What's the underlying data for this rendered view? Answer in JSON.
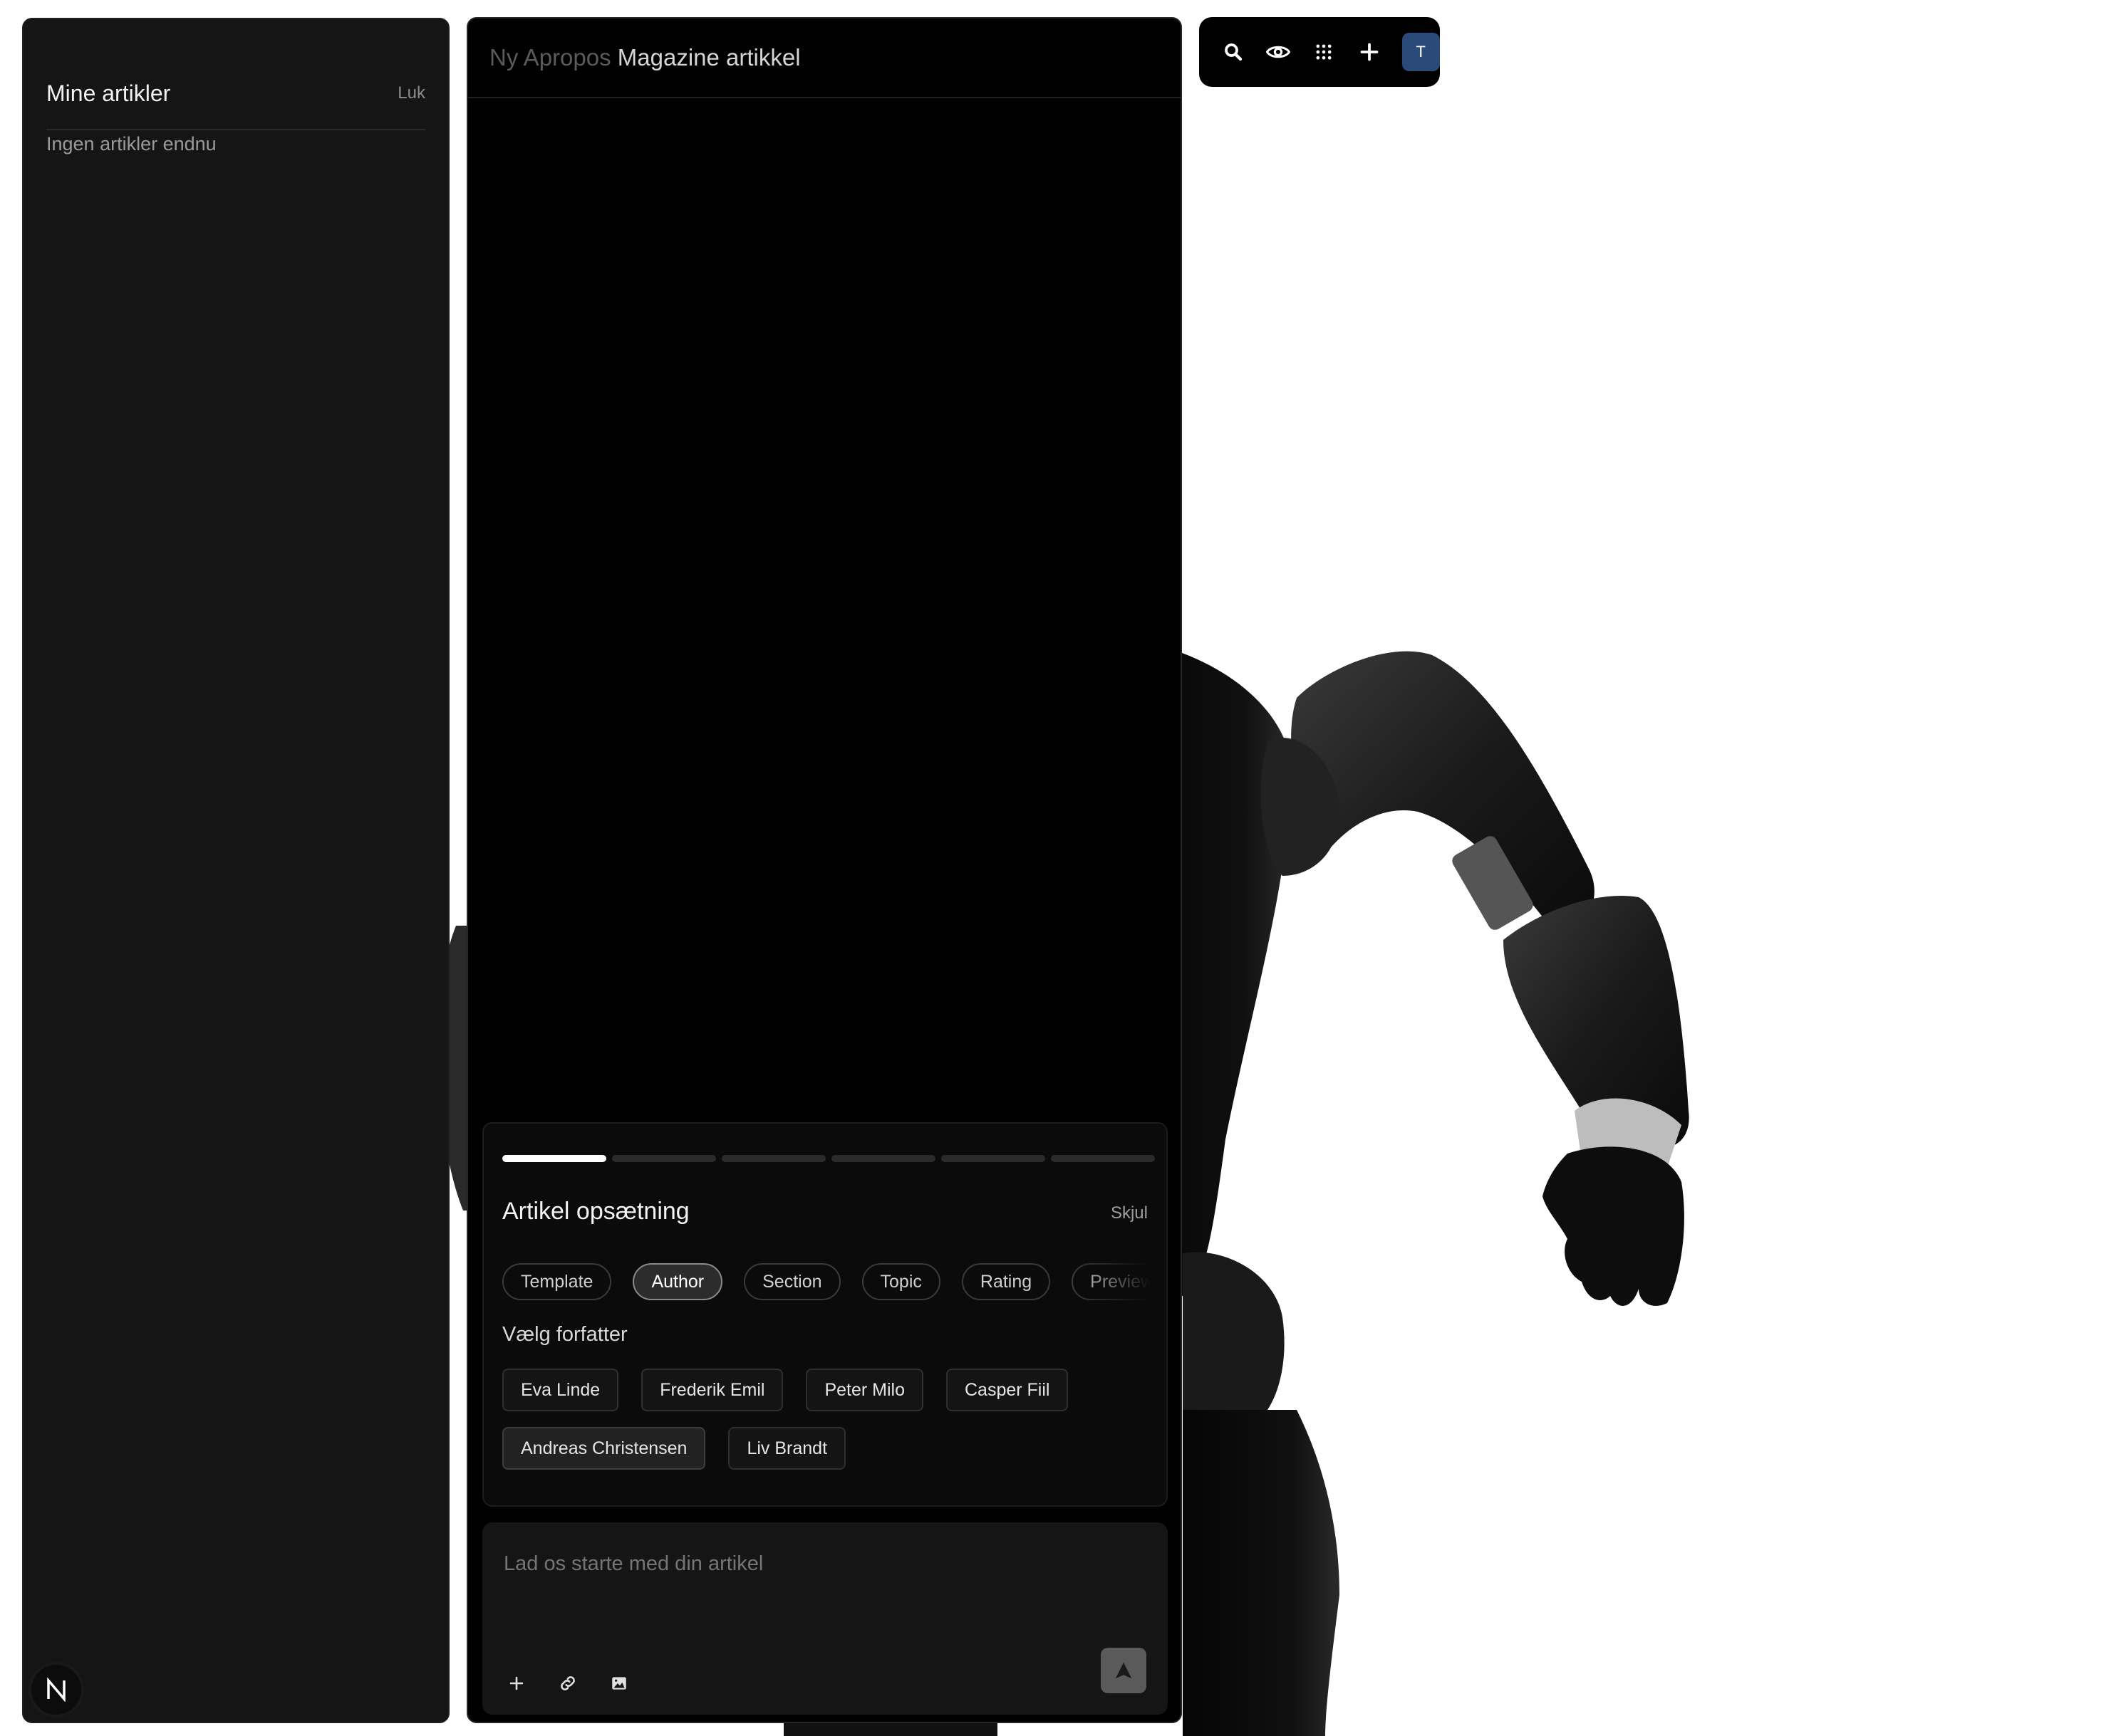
{
  "sidebar": {
    "title": "Mine artikler",
    "close_label": "Luk",
    "empty_text": "Ingen artikler endnu",
    "logo_letter": "N"
  },
  "editor": {
    "title_dim": "Ny Apropos ",
    "title_lit": "Magazine artikkel"
  },
  "setup": {
    "steps_total": 6,
    "current_step": 1,
    "title": "Artikel opsætning",
    "hide_label": "Skjul",
    "tabs": [
      {
        "label": "Template",
        "selected": false
      },
      {
        "label": "Author",
        "selected": true
      },
      {
        "label": "Section",
        "selected": false
      },
      {
        "label": "Topic",
        "selected": false
      },
      {
        "label": "Rating",
        "selected": false
      },
      {
        "label": "Preview",
        "selected": false
      }
    ],
    "choose_label": "Vælg forfatter",
    "authors_row1": [
      "Eva Linde",
      "Frederik Emil",
      "Peter Milo",
      "Casper Fiil"
    ],
    "authors_row2": [
      "Andreas Christensen",
      "Liv Brandt"
    ]
  },
  "composer": {
    "placeholder": "Lad os starte med din artikel",
    "tools": [
      "plus-icon",
      "link-icon",
      "image-icon"
    ],
    "send_icon": "send-arrow-icon"
  },
  "toolbar": {
    "icons": [
      "search-icon",
      "eye-icon",
      "grid-icon",
      "plus-icon"
    ],
    "avatar_letter": "T",
    "avatar_color": "#2a4a7a"
  }
}
